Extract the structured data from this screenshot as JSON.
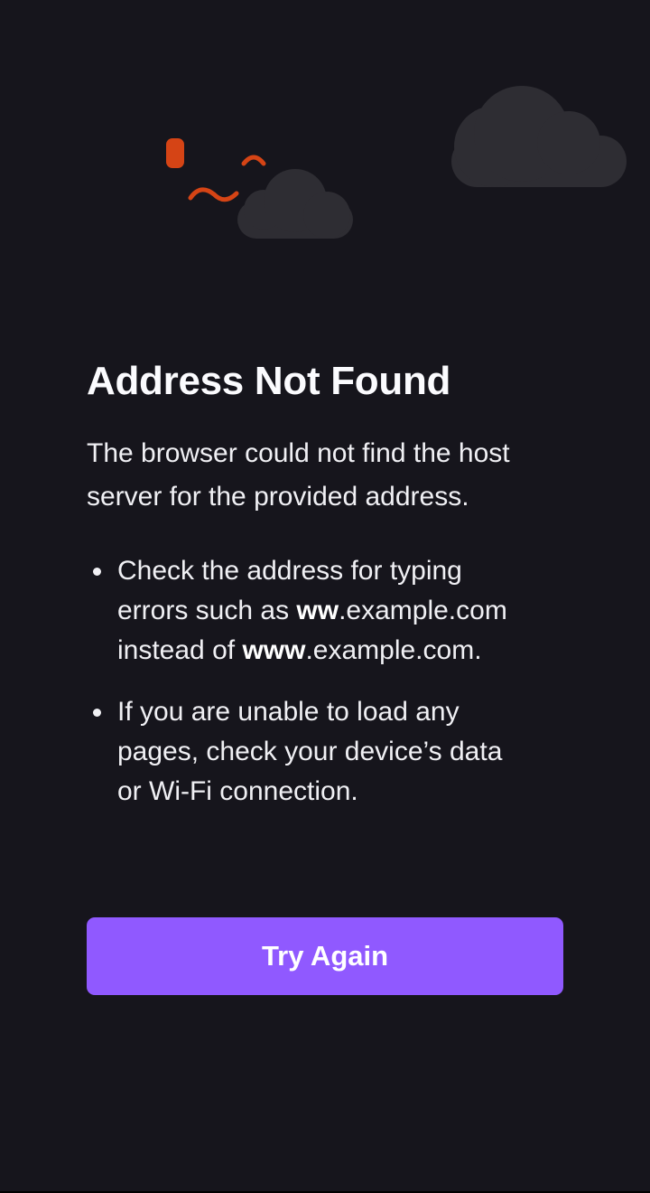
{
  "error_page": {
    "title": "Address Not Found",
    "description": "The browser could not find the host server for the provided address.",
    "tips": [
      {
        "line1": "Check the address for typing errors such as ",
        "bold1": "ww",
        "middle": ".example.com instead of ",
        "bold2": "www",
        "end": ".example.com."
      },
      {
        "text": "If you are unable to load any pages, check your device’s data or Wi-Fi connection."
      }
    ],
    "button_label": "Try Again"
  },
  "colors": {
    "background": "#16151c",
    "accent": "#9059ff",
    "illustration_orange": "#d54415",
    "cloud": "#2e2d33"
  },
  "icons": [
    "large-cloud-icon",
    "small-cloud-icon",
    "broken-connection-icon"
  ]
}
